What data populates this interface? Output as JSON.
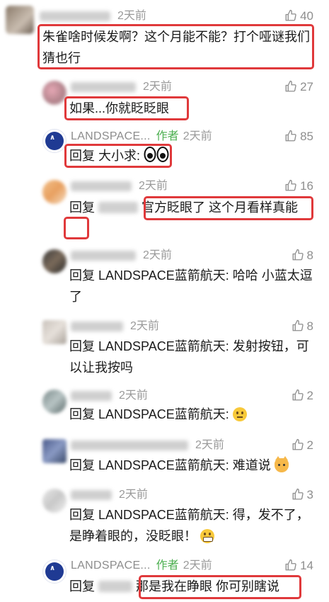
{
  "colors": {
    "highlight": "#e0393b",
    "author": "#4caf50",
    "meta": "#9a9a9a"
  },
  "comments": [
    {
      "time": "2天前",
      "likes": "40",
      "text": "朱雀啥时候发啊？这个月能不能？打个哑谜我们猜也行"
    },
    {
      "time": "2天前",
      "likes": "27",
      "text": "如果...你就眨眨眼"
    },
    {
      "user": "LANDSPACE...",
      "author_tag": "作者",
      "time": "2天前",
      "likes": "85",
      "reply_prefix": "回复",
      "reply_to": "大小求",
      "text": ":"
    },
    {
      "time": "2天前",
      "likes": "16",
      "reply_prefix": "回复",
      "text": "官方眨眼了  这个月看样真能"
    },
    {
      "time": "2天前",
      "likes": "8",
      "reply_prefix": "回复",
      "reply_to": "LANDSPACE蓝箭航天",
      "text": ": 哈哈 小蓝太逗了"
    },
    {
      "time": "2天前",
      "likes": "8",
      "reply_prefix": "回复",
      "reply_to": "LANDSPACE蓝箭航天",
      "text": ": 发射按钮，可以让我按吗"
    },
    {
      "time": "2天前",
      "likes": "2",
      "reply_prefix": "回复",
      "reply_to": "LANDSPACE蓝箭航天",
      "text": ":"
    },
    {
      "time": "2天前",
      "likes": "2",
      "reply_prefix": "回复",
      "reply_to": "LANDSPACE蓝箭航天",
      "text": ": 难道说"
    },
    {
      "time": "2天前",
      "likes": "3",
      "reply_prefix": "回复",
      "reply_to": "LANDSPACE蓝箭航天",
      "text": ": 得，发不了，是睁着眼的，没眨眼！"
    },
    {
      "user": "LANDSPACE...",
      "author_tag": "作者",
      "time": "2天前",
      "likes": "14",
      "reply_prefix": "回复",
      "text": "那是我在睁眼 你可别瞎说"
    }
  ]
}
